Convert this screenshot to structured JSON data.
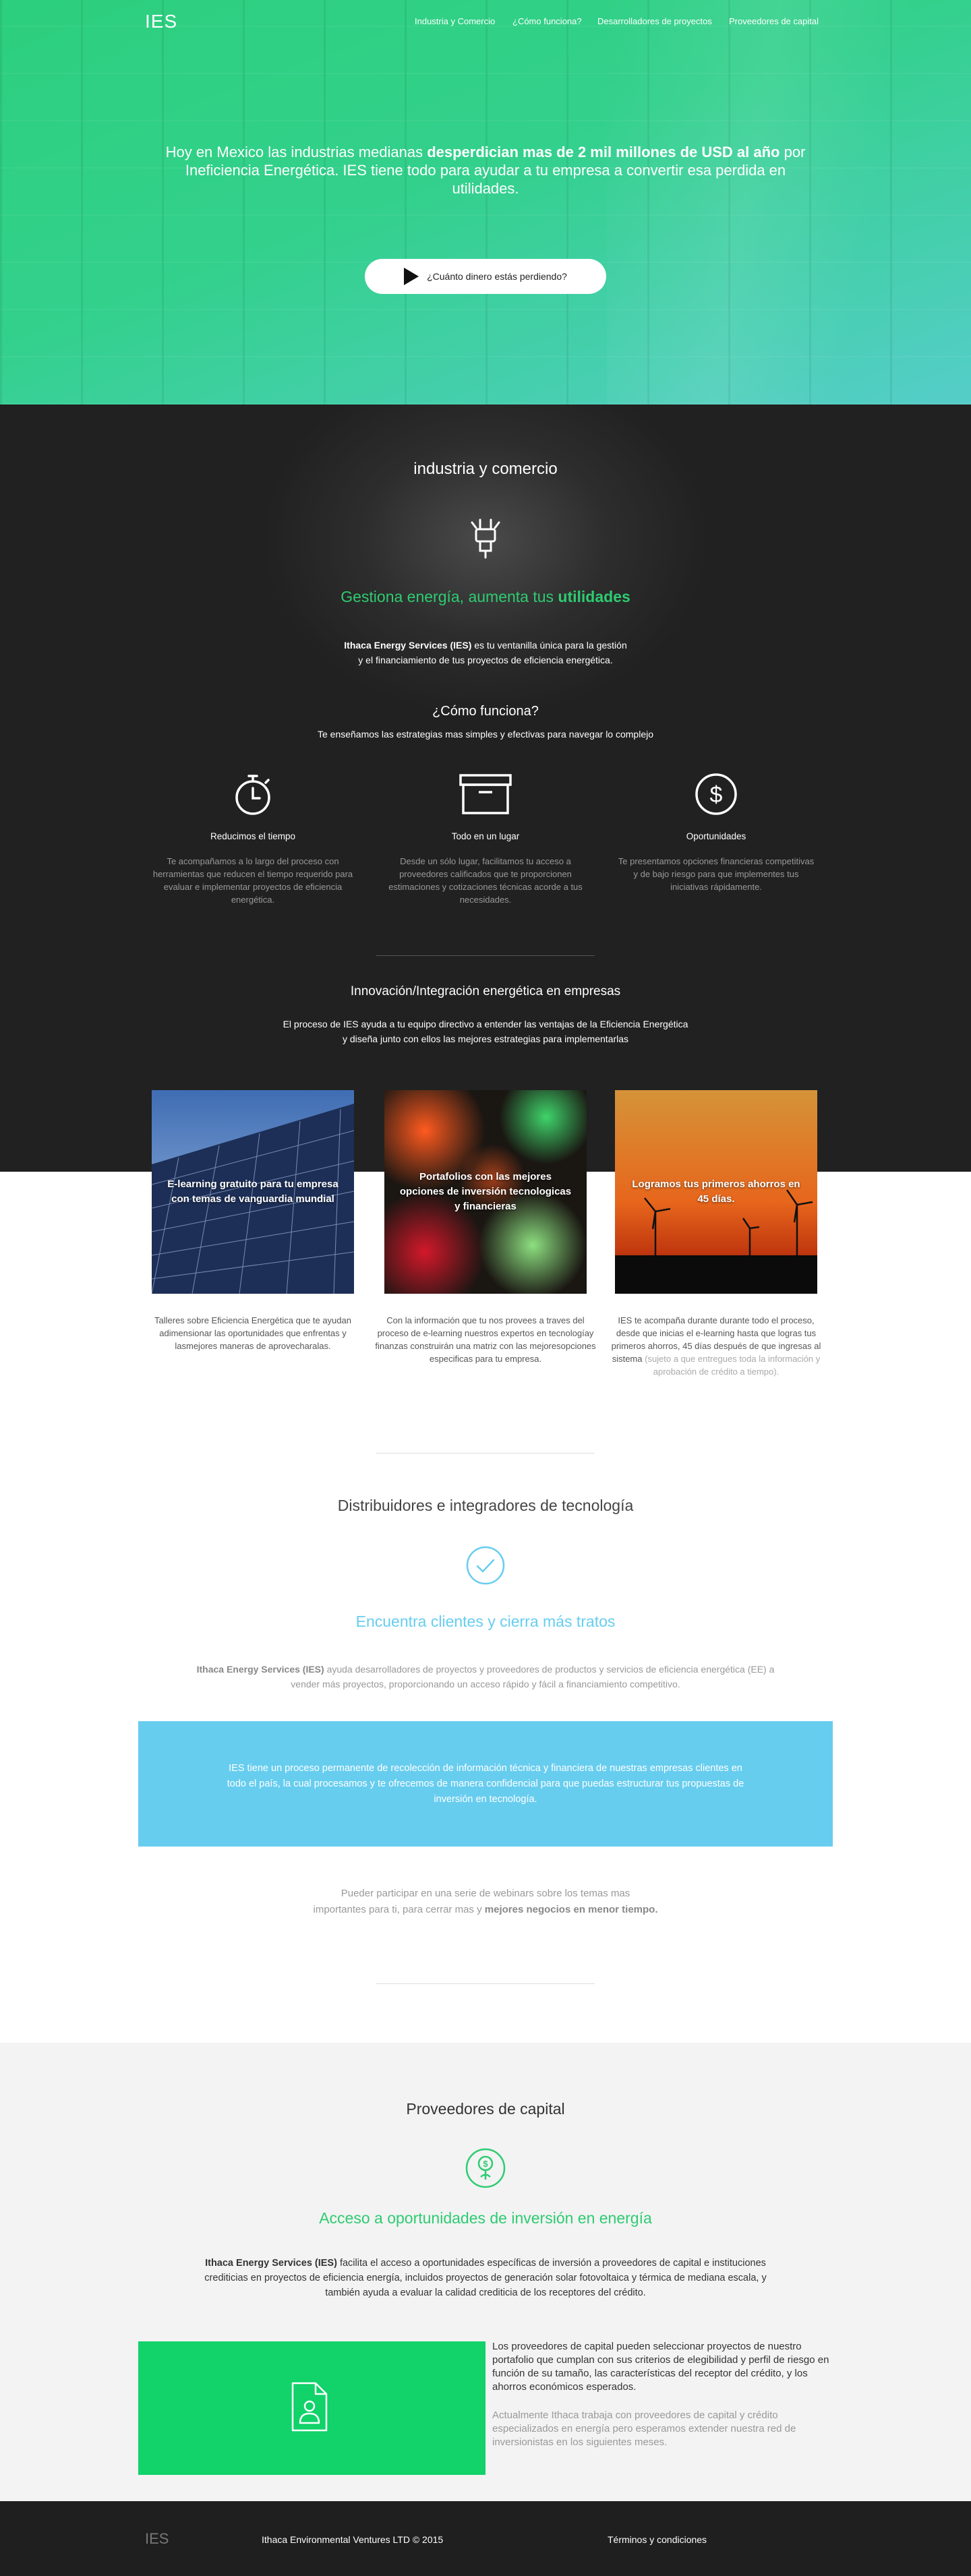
{
  "header": {
    "logo": "IES",
    "nav": [
      "Industria y Comercio",
      "¿Cómo funciona?",
      "Desarrolladores de proyectos",
      "Proveedores de capital"
    ]
  },
  "hero": {
    "text_pre": "Hoy en Mexico las industrias medianas ",
    "text_bold": "desperdician mas de 2 mil millones de USD al año",
    "text_post": " por Ineficiencia Energética. IES tiene todo para ayudar a tu empresa a convertir esa perdida en utilidades.",
    "cta_label": "¿Cuánto dinero estás perdiendo?"
  },
  "industria": {
    "title": "industria y comercio",
    "tagline_pre": "Gestiona energía, aumenta tus ",
    "tagline_bold": "utilidades",
    "intro_bold": "Ithaca Energy Services (IES)",
    "intro_line1": " es tu ventanilla única para la gestión",
    "intro_line2": "y el financiamiento de tus proyectos de eficiencia energética.",
    "how_title": "¿Cómo funciona?",
    "how_subtitle": "Te enseñamos las estrategias mas simples y efectivas para navegar lo complejo",
    "features": [
      {
        "icon": "stopwatch-icon",
        "title": "Reducimos el tiempo",
        "desc": "Te acompañamos a lo largo del proceso con herramientas que reducen el tiempo requerido para evaluar e implementar proyectos de eficiencia energética."
      },
      {
        "icon": "box-icon",
        "title": "Todo en un lugar",
        "desc": "Desde un sólo lugar, facilitamos tu acceso a proveedores calificados que te proporcionen estimaciones y cotizaciones técnicas acorde a tus necesidades."
      },
      {
        "icon": "dollar-icon",
        "title": "Oportunidades",
        "desc": "Te presentamos opciones financieras competitivas y de bajo riesgo para que implementes tus iniciativas rápidamente."
      }
    ],
    "innovation_title": "Innovación/Integración energética en empresas",
    "innovation_line1": "El proceso de IES ayuda a tu equipo directivo a entender las ventajas de la Eficiencia Energética",
    "innovation_line2": "y diseña junto con ellos las mejores estrategias para implementarlas"
  },
  "cards": [
    {
      "label": "E-learning gratuito para tu empresa con temas de vanguardia mundial",
      "desc": "Talleres sobre Eficiencia Energética que te ayudan adimensionar las oportunidades que enfrentas y lasmejores maneras de aprovecharalas.",
      "desc_muted": ""
    },
    {
      "label": "Portafolios con las mejores opciones de inversión tecnologicas y financieras",
      "desc": "Con la información que tu nos provees a traves del proceso de e-learning nuestros expertos en tecnologíay finanzas construirán una matriz con las mejoresopciones especificas para tu empresa.",
      "desc_muted": ""
    },
    {
      "label": "Logramos tus primeros ahorros en 45 días.",
      "desc": "IES te acompaña durante durante todo el proceso, desde que inicias el e-learning hasta que logras tus primeros ahorros, 45 días después de que ingresas al sistema ",
      "desc_muted": "(sujeto a que entregues toda la información y aprobación de crédito a tiempo)."
    }
  ],
  "distribuidores": {
    "title": "Distribuidores e integradores de tecnología",
    "tagline": "Encuentra clientes y cierra más tratos",
    "intro_bold": "Ithaca Energy Services (IES)",
    "intro_line1": " ayuda desarrolladores de proyectos y proveedores de productos y servicios de eficiencia energética (EE) a",
    "intro_line2": "vender más proyectos, proporcionando un acceso rápido y fácil a financiamiento competitivo.",
    "box_text": "IES tiene un proceso permanente de recolección de información técnica y financiera de nuestras empresas clientes en todo el país, la cual procesamos y te ofrecemos de manera confidencial para que puedas estructurar tus propuestas de inversión en tecnología.",
    "webinar_line1": "Pueder participar en una serie de webinars sobre los temas mas",
    "webinar_line2_pre": "importantes para ti, para cerrar mas y ",
    "webinar_bold": "mejores negocios en menor tiempo."
  },
  "capital": {
    "title": "Proveedores de capital",
    "tagline": "Acceso a oportunidades de inversión en energía",
    "intro_bold": "Ithaca Energy Services (IES)",
    "intro_line1": " facilita el acceso a oportunidades específicas de inversión a proveedores de capital e instituciones",
    "intro_line2": "crediticias en proyectos de eficiencia energía, incluidos proyectos de generación solar fotovoltaica y térmica de mediana escala, y",
    "intro_line3": "también ayuda a evaluar la calidad crediticia de los receptores del crédito.",
    "text_main": "Los proveedores de capital pueden seleccionar proyectos de nuestro portafolio que cumplan con sus criterios de elegibilidad y perfil de riesgo en función de su tamaño, las características del receptor del crédito, y los ahorros económicos esperados.",
    "text_muted": "Actualmente Ithaca trabaja con proveedores de capital y crédito especializados en energía pero esperamos extender nuestra red de inversionistas en los siguientes meses."
  },
  "footer": {
    "logo": "IES",
    "copyright": "Ithaca Environmental Ventures LTD © 2015",
    "terms": "Términos y condiciones"
  },
  "colors": {
    "accent_green": "#2ecc71",
    "accent_blue": "#67cdef",
    "dark_bg": "#222222",
    "footer_bg": "#1f1f1f"
  }
}
